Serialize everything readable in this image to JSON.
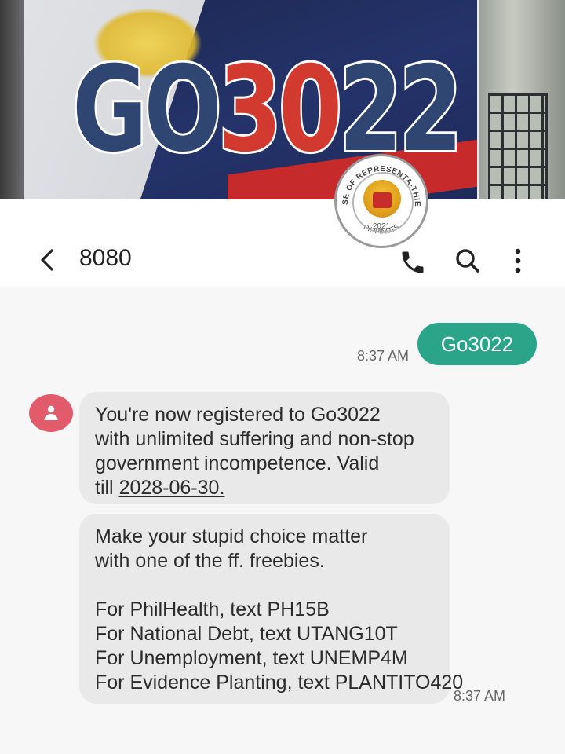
{
  "banner": {
    "text_part1": "GO",
    "text_part2": "30",
    "text_part3": "22"
  },
  "seal": {
    "top_text": "HOUSE OF REPRESENTA-THIEVES",
    "bottom_text": "PILIPINUTS",
    "year": "2021"
  },
  "header": {
    "contact": "8080"
  },
  "messages": {
    "sent": {
      "text": "Go3022",
      "time": "8:37 AM"
    },
    "received_1": {
      "line1": "You're now registered to Go3022",
      "line2": "with unlimited suffering and non-stop",
      "line3": "government incompetence. Valid",
      "line4_prefix": "till ",
      "line4_date": "2028-06-30."
    },
    "received_2": {
      "line1": "Make your stupid choice matter",
      "line2": "with one of the ff. freebies.",
      "line3": "For PhilHealth, text PH15B",
      "line4": "For National Debt, text UTANG10T",
      "line5": "For Unemployment, text UNEMP4M",
      "line6": "For Evidence Planting, text PLANTITO420",
      "time": "8:37 AM"
    }
  },
  "colors": {
    "sent_bubble": "#2aa58a",
    "avatar": "#e25b6b",
    "received_bubble": "#e9e9ea"
  }
}
